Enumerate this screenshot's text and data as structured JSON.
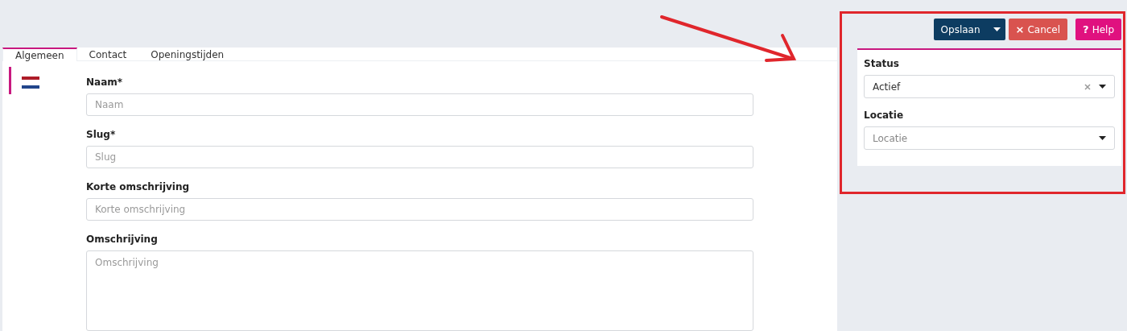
{
  "tabs": [
    {
      "label": "Algemeen",
      "selected": true
    },
    {
      "label": "Contact",
      "selected": false
    },
    {
      "label": "Openingstijden",
      "selected": false
    }
  ],
  "language_tabs": [
    {
      "kind": "flag-nl",
      "selected": true
    }
  ],
  "form": {
    "fields": [
      {
        "kind": "input",
        "label": "Naam*",
        "placeholder": "Naam"
      },
      {
        "kind": "input",
        "label": "Slug*",
        "placeholder": "Slug"
      },
      {
        "kind": "input",
        "label": "Korte omschrijving",
        "placeholder": "Korte omschrijving"
      },
      {
        "kind": "textarea",
        "label": "Omschrijving",
        "placeholder": "Omschrijving"
      }
    ]
  },
  "toolbar": {
    "buttons": [
      {
        "kind": "save",
        "label": "Opslaan",
        "has_menu": true
      },
      {
        "kind": "cancel",
        "icon": "×",
        "label": "Cancel"
      },
      {
        "kind": "help",
        "icon": "?",
        "label": "Help"
      }
    ]
  },
  "side_panel": {
    "fields": [
      {
        "label": "Status",
        "value": "Actief",
        "clearable": true
      },
      {
        "label": "Locatie",
        "placeholder": "Locatie",
        "clearable": false
      }
    ]
  },
  "annotations": {
    "arrow": true,
    "frame": true
  }
}
